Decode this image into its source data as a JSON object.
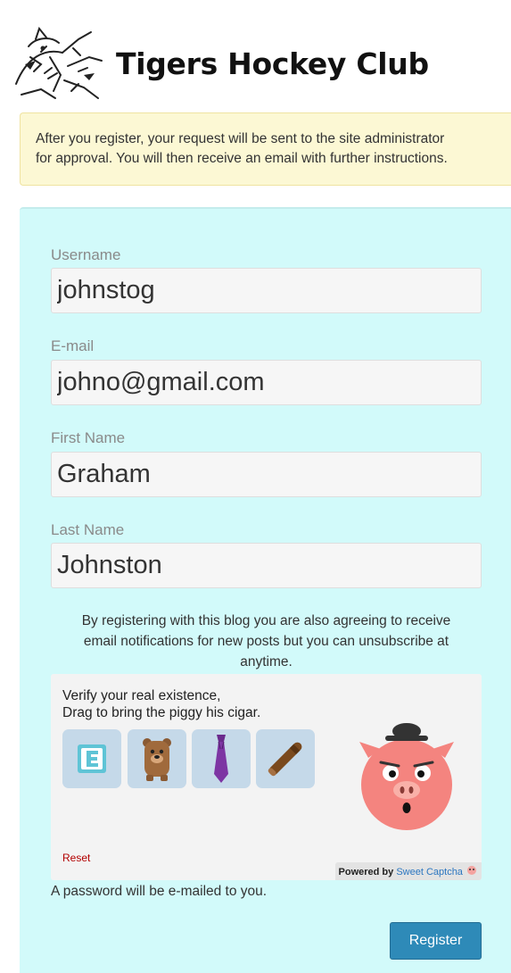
{
  "site": {
    "title": "Tigers Hockey Club"
  },
  "notice": {
    "line1": "After you register, your request will be sent to the site administrator",
    "line2": "for approval. You will then receive an email with further instructions."
  },
  "form": {
    "username": {
      "label": "Username",
      "value": "johnstog"
    },
    "email": {
      "label": "E-mail",
      "value": "johno@gmail.com"
    },
    "first_name": {
      "label": "First Name",
      "value": "Graham"
    },
    "last_name": {
      "label": "Last Name",
      "value": "Johnston"
    },
    "agreement": {
      "line1": "By registering with this blog you are also agreeing to receive",
      "line2": "email notifications for new posts but you can unsubscribe at",
      "line3": "anytime."
    },
    "password_note": "A password will be e-mailed to you.",
    "register_label": "Register"
  },
  "captcha": {
    "title": "Verify your real existence,",
    "instruction": "Drag to bring the piggy his cigar.",
    "items": [
      "e-logo-icon",
      "bear-icon",
      "tie-icon",
      "cigar-icon"
    ],
    "reset_label": "Reset",
    "powered_prefix": "Powered by",
    "powered_link": "Sweet Captcha"
  },
  "colors": {
    "panel": "#d2fafa",
    "notice": "#fcf8d4",
    "button": "#2e8ab8",
    "tile": "#c5d9e9",
    "pig": "#f4847f"
  }
}
